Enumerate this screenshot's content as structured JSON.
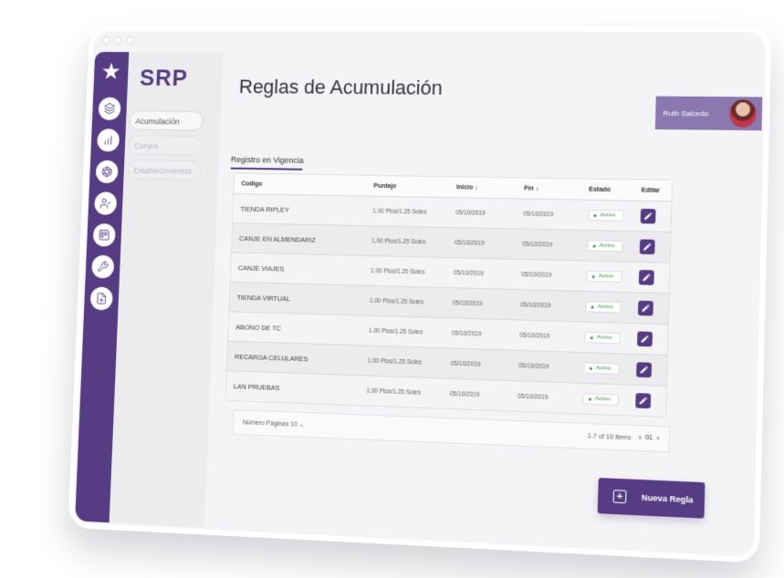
{
  "app": {
    "brand": "SRP",
    "logo": "star-icon"
  },
  "rail": {
    "icons": [
      "layers-icon",
      "bar-chart-icon",
      "aperture-icon",
      "user-check-icon",
      "trello-icon",
      "tool-icon",
      "file-plus-icon"
    ]
  },
  "sidebar": {
    "items": [
      {
        "label": "Acumulación",
        "active": true
      },
      {
        "label": "Canjes",
        "active": false
      },
      {
        "label": "Establecimientos",
        "active": false
      }
    ]
  },
  "header": {
    "title": "Reglas de Acumulación",
    "user_name": "Ruth Salcedo"
  },
  "tabs": {
    "active_label": "Registro en Vigencia"
  },
  "table": {
    "headers": {
      "code": "Codigo",
      "points": "Puntaje",
      "start": "Inicio  ↓",
      "end": "Fin  ↓",
      "status": "Estado",
      "edit": "Editar"
    },
    "rows": [
      {
        "code": "TIENDA RIPLEY",
        "points": "1.00 Ptos/1.25 Soles",
        "start": "05/10/2019",
        "end": "05/10/2019",
        "status": "Activo"
      },
      {
        "code": "CANJE EN ALMENDARIZ",
        "points": "1.00 Ptos/1.25 Soles",
        "start": "05/10/2019",
        "end": "05/10/2019",
        "status": "Activo"
      },
      {
        "code": "CANJE VIAJES",
        "points": "1.00 Ptos/1.25 Soles",
        "start": "05/10/2019",
        "end": "05/10/2019",
        "status": "Activo"
      },
      {
        "code": "TIENDA VIRTUAL",
        "points": "1.00 Ptos/1.25 Soles",
        "start": "05/10/2019",
        "end": "05/10/2019",
        "status": "Activo"
      },
      {
        "code": "ABONO DE TC",
        "points": "1.00 Ptos/1.25 Soles",
        "start": "05/10/2019",
        "end": "05/10/2019",
        "status": "Activo"
      },
      {
        "code": "RECARGA CELULARES",
        "points": "1.00 Ptos/1.25 Soles",
        "start": "05/10/2019",
        "end": "05/10/2019",
        "status": "Activo"
      },
      {
        "code": "LAN PRUEBAS",
        "points": "1.00 Ptos/1.25 Soles",
        "start": "05/10/2019",
        "end": "05/10/2019",
        "status": "Activo"
      }
    ]
  },
  "pager": {
    "page_size_label": "Número Páginas",
    "page_size_value": "10",
    "range": "1-7 of 10 items",
    "current_page": "01"
  },
  "actions": {
    "new_rule_label": "Nueva Regla"
  },
  "colors": {
    "brand": "#563c83",
    "active_status": "#3f9a4c",
    "user_chip": "#8b78ae"
  }
}
